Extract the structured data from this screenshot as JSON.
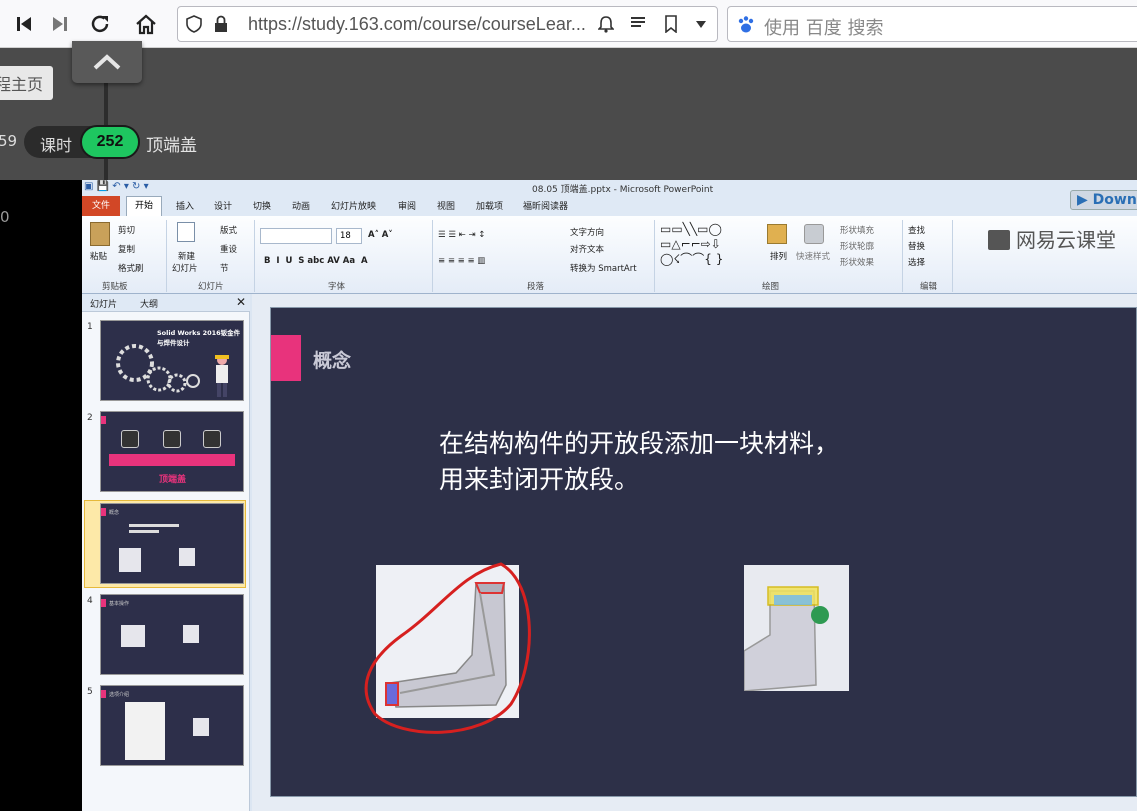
{
  "browser": {
    "url": "https://study.163.com/course/courseLear...",
    "search_placeholder": "使用 百度 搜索"
  },
  "course": {
    "home_button": "程主页",
    "left_number": "59",
    "lesson_label": "课时",
    "lesson_number": "252",
    "lesson_title": "顶端盖",
    "left_zero": "0"
  },
  "ppt": {
    "window_title": "08.05 顶端盖.pptx - Microsoft PowerPoint",
    "tabs": [
      "文件",
      "开始",
      "插入",
      "设计",
      "切换",
      "动画",
      "幻灯片放映",
      "审阅",
      "视图",
      "加载项",
      "福昕阅读器"
    ],
    "ribbon": {
      "paste": "粘贴",
      "cut": "剪切",
      "copy": "复制",
      "format_painter": "格式刷",
      "clipboard_group": "剪贴板",
      "new_slide": "新建",
      "new_slide2": "幻灯片",
      "layout": "版式",
      "reset": "重设",
      "section": "节",
      "slides_group": "幻灯片",
      "font_size": "18",
      "font_group": "字体",
      "text_direction": "文字方向",
      "align_text": "对齐文本",
      "smartart": "转换为 SmartArt",
      "paragraph_group": "段落",
      "arrange": "排列",
      "quick_styles": "快速样式",
      "shape_fill": "形状填充",
      "shape_outline": "形状轮廓",
      "shape_effects": "形状效果",
      "drawing_group": "绘图",
      "find": "查找",
      "replace": "替换",
      "select": "选择",
      "editing_group": "编辑"
    },
    "logo": "网易云课堂",
    "download": "Down",
    "pane_tabs": [
      "幻灯片",
      "大纲"
    ],
    "thumbnails": [
      {
        "num": "1",
        "title": "Solid Works 2016钣金件与焊件设计"
      },
      {
        "num": "2",
        "title": "顶端盖"
      },
      {
        "num": "3",
        "title": "概念"
      },
      {
        "num": "4",
        "title": "基本操作"
      },
      {
        "num": "5",
        "title": "选项介绍"
      }
    ],
    "slide": {
      "heading": "概念",
      "body": "在结构构件的开放段添加一块材料，用来封闭开放段。"
    }
  },
  "colors": {
    "slide_bg": "#2d3048",
    "accent": "#e8337c",
    "lesson_green": "#1ec660",
    "file_tab": "#d24726"
  }
}
